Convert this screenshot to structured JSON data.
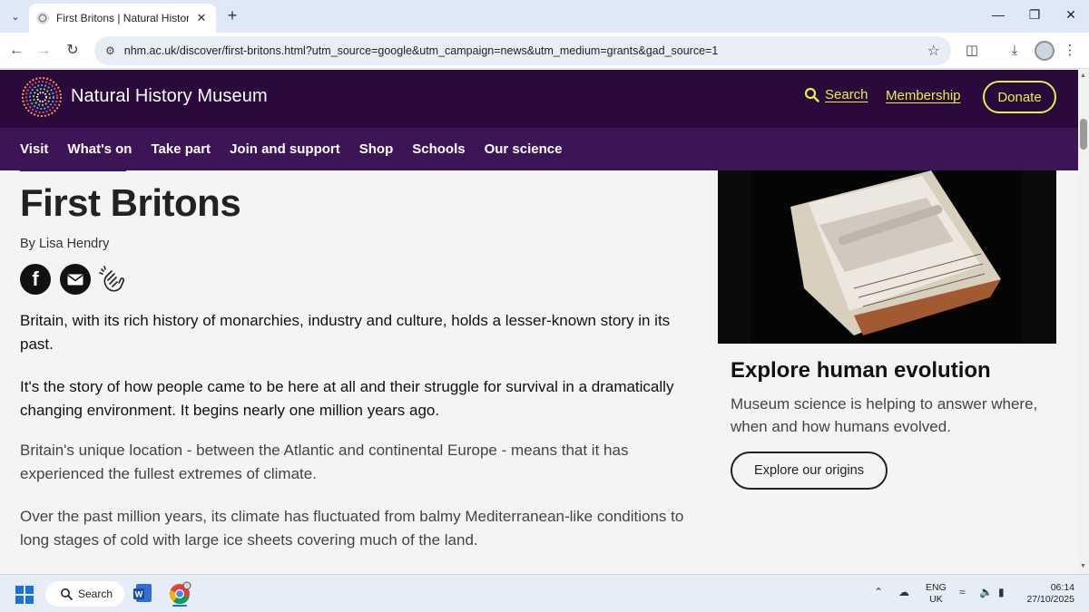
{
  "browser": {
    "tab_title": "First Britons | Natural History M",
    "url": "nhm.ac.uk/discover/first-britons.html?utm_source=google&utm_campaign=news&utm_medium=grants&gad_source=1",
    "icons": [
      "tab-menu-chevron-icon",
      "close-icon",
      "plus-icon",
      "minimize-icon",
      "restore-icon",
      "back-icon",
      "forward-icon",
      "reload-icon",
      "site-info-icon",
      "star-icon",
      "extensions-icon",
      "download-icon",
      "menu-dots-icon"
    ]
  },
  "site": {
    "logo_text": "Natural History Museum",
    "search_label": "Search",
    "membership_label": "Membership",
    "donate_label": "Donate",
    "nav": [
      {
        "label": "Visit"
      },
      {
        "label": "What's on"
      },
      {
        "label": "Take part"
      },
      {
        "label": "Join and support"
      },
      {
        "label": "Shop"
      },
      {
        "label": "Schools"
      },
      {
        "label": "Our science"
      }
    ],
    "colors": {
      "header_bg": "#2a0a3d",
      "nav_bg": "#3b1556",
      "accent": "#e4f04a"
    }
  },
  "article": {
    "title": "First Britons",
    "byline": "By Lisa Hendry",
    "share_fb_glyph": "f",
    "lede_1": "Britain, with its rich history of monarchies, industry and culture, holds a lesser-known story in its past.",
    "lede_2": "It's the story of how people came to be here at all and their struggle for survival in a dramatically changing environment. It begins nearly one million years ago.",
    "para_1": "Britain's unique location - between the Atlantic and continental Europe - means that it has experienced the fullest extremes of climate.",
    "para_2": "Over the past million years, its climate has fluctuated from balmy Mediterranean-like conditions to long stages of cold with large ice sheets covering much of the land."
  },
  "sidebar": {
    "title": "Explore human evolution",
    "description": "Museum science is helping to answer where, when and how humans evolved.",
    "button_label": "Explore our origins"
  },
  "taskbar": {
    "search_label": "Search",
    "lang_1": "ENG",
    "lang_2": "UK",
    "time": "06:14",
    "date": "27/10/2025"
  }
}
